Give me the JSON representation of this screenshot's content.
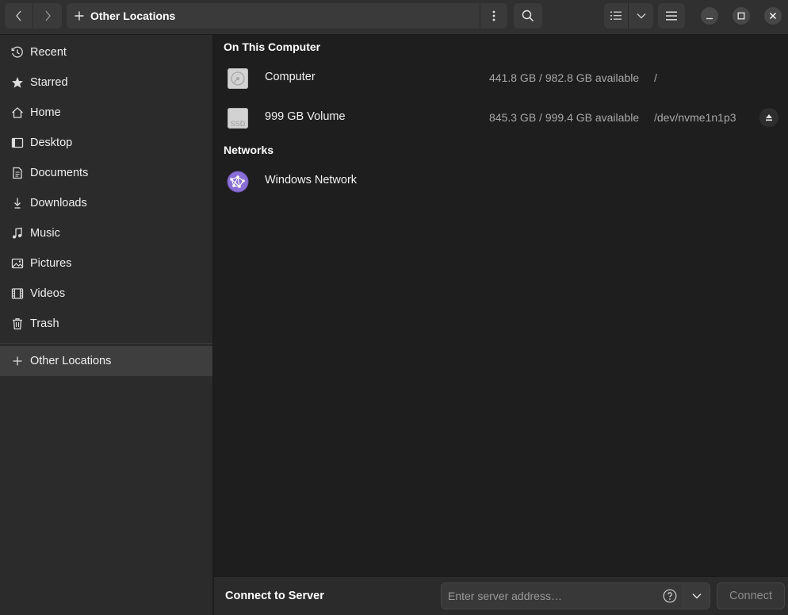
{
  "header": {
    "path_label": "Other Locations",
    "icons": {
      "back": "chevron-left-icon",
      "forward": "chevron-right-icon",
      "path": "plus-icon",
      "path_menu": "vertical-dots-icon",
      "search": "search-icon",
      "view": "list-view-icon",
      "view_options": "chevron-down-icon",
      "menu": "hamburger-icon",
      "minimize": "minimize-icon",
      "maximize": "maximize-icon",
      "close": "close-icon"
    }
  },
  "sidebar": {
    "items": [
      {
        "label": "Recent",
        "icon": "clock-icon"
      },
      {
        "label": "Starred",
        "icon": "star-icon"
      },
      {
        "label": "Home",
        "icon": "home-icon"
      },
      {
        "label": "Desktop",
        "icon": "desktop-icon"
      },
      {
        "label": "Documents",
        "icon": "document-icon"
      },
      {
        "label": "Downloads",
        "icon": "download-icon"
      },
      {
        "label": "Music",
        "icon": "music-icon"
      },
      {
        "label": "Pictures",
        "icon": "picture-icon"
      },
      {
        "label": "Videos",
        "icon": "video-icon"
      },
      {
        "label": "Trash",
        "icon": "trash-icon"
      }
    ],
    "other_locations": {
      "label": "Other Locations",
      "icon": "plus-icon",
      "active": true
    }
  },
  "main": {
    "on_this_computer": {
      "title": "On This Computer",
      "devices": [
        {
          "name": "Computer",
          "available": "441.8 GB / 982.8 GB available",
          "mount": "/",
          "icon": "harddisk-icon"
        },
        {
          "name": "999 GB Volume",
          "available": "845.3 GB / 999.4 GB available",
          "mount": "/dev/nvme1n1p3",
          "icon": "ssd-icon",
          "icon_text": "SSD",
          "ejectable": true
        }
      ]
    },
    "networks": {
      "title": "Networks",
      "items": [
        {
          "name": "Windows Network",
          "icon": "network-icon"
        }
      ]
    }
  },
  "bottom": {
    "title": "Connect to Server",
    "placeholder": "Enter server address…",
    "connect_label": "Connect",
    "icons": {
      "help": "help-icon",
      "dropdown": "chevron-down-icon"
    }
  },
  "colors": {
    "window_bg": "#1e1e1e",
    "sidebar_bg": "#2b2b2b",
    "header_bg": "#303030",
    "network_icon": "#8a6fd6"
  }
}
